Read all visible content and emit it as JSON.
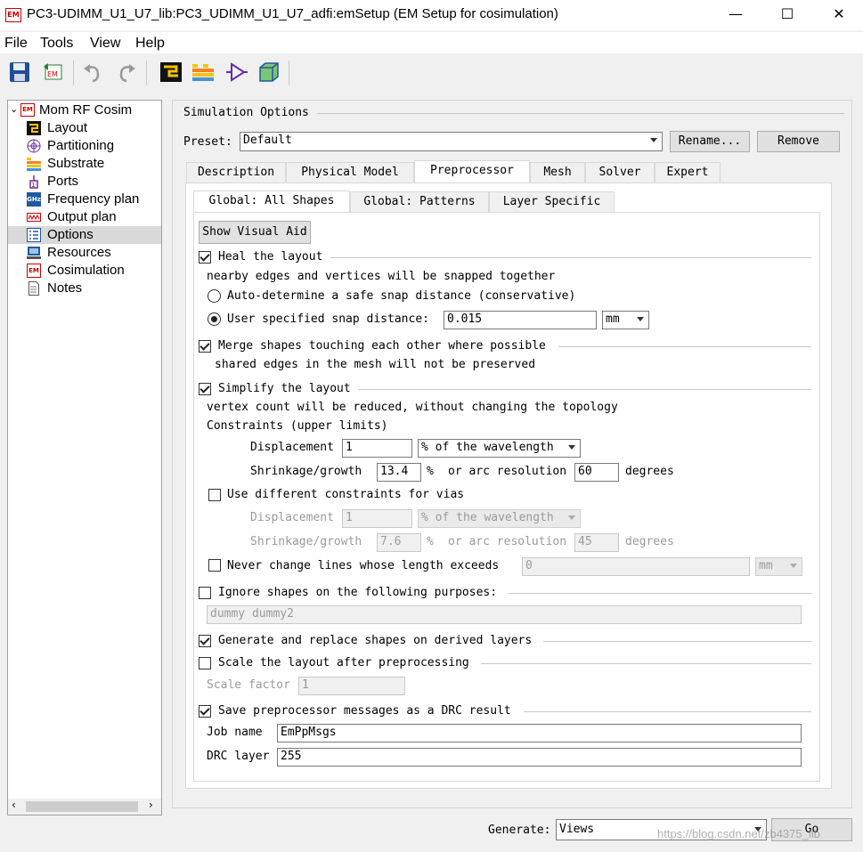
{
  "window": {
    "title": "PC3-UDIMM_U1_U7_lib:PC3_UDIMM_U1_U7_adfi:emSetup (EM Setup for cosimulation)",
    "badge": "EM",
    "minimize": "—",
    "maximize": "☐",
    "close": "✕"
  },
  "menu": [
    "File",
    "Tools",
    "View",
    "Help"
  ],
  "toolbar": [
    "save-icon",
    "export-icon",
    "undo-icon",
    "redo-icon",
    "layout-icon",
    "substrate-icon",
    "port-icon",
    "3d-view-icon"
  ],
  "tree": {
    "root": "Mom RF Cosim",
    "root_badge": "EM",
    "items": [
      {
        "label": "Layout",
        "icon": "layout-icon"
      },
      {
        "label": "Partitioning",
        "icon": "partitioning-icon"
      },
      {
        "label": "Substrate",
        "icon": "substrate-icon"
      },
      {
        "label": "Ports",
        "icon": "ports-icon"
      },
      {
        "label": "Frequency plan",
        "icon": "frequency-plan-icon",
        "badge": "GHz"
      },
      {
        "label": "Output plan",
        "icon": "output-plan-icon"
      },
      {
        "label": "Options",
        "icon": "options-icon"
      },
      {
        "label": "Resources",
        "icon": "resources-icon"
      },
      {
        "label": "Cosimulation",
        "icon": "cosimulation-icon",
        "badge": "EM"
      },
      {
        "label": "Notes",
        "icon": "notes-icon"
      }
    ],
    "selected": "Options"
  },
  "simulation": {
    "group_title": "Simulation Options",
    "preset_label": "Preset:",
    "preset_value": "Default",
    "rename_button": "Rename...",
    "remove_button": "Remove"
  },
  "tabs": [
    "Description",
    "Physical Model",
    "Preprocessor",
    "Mesh",
    "Solver",
    "Expert"
  ],
  "active_tab": "Preprocessor",
  "subtabs": [
    "Global: All Shapes",
    "Global: Patterns",
    "Layer Specific"
  ],
  "active_subtab": "Global: All Shapes",
  "pre": {
    "show_visual_aid": "Show Visual Aid",
    "heal": {
      "label": "Heal the layout",
      "checked": true,
      "desc": "nearby edges and vertices will be snapped together",
      "auto": "Auto-determine a safe snap distance (conservative)",
      "user": "User specified snap distance:",
      "snap_value": "0.015",
      "snap_unit": "mm"
    },
    "merge": {
      "label": "Merge shapes touching each other where possible",
      "checked": true,
      "desc": "shared edges in the mesh will not be preserved"
    },
    "simplify": {
      "label": "Simplify the layout",
      "checked": true,
      "desc": "vertex count will be reduced, without changing the topology",
      "constraints": "Constraints (upper limits)",
      "displacement_label": "Displacement",
      "displacement_value": "1",
      "displacement_unit": "% of the wavelength",
      "shrink_label": "Shrinkage/growth",
      "shrink_value": "13.4",
      "percent": "%",
      "arc_label": "or arc resolution",
      "arc_value": "60",
      "degrees": "degrees"
    },
    "vias": {
      "label": "Use different constraints for vias",
      "checked": false,
      "displacement_label": "Displacement",
      "displacement_value": "1",
      "displacement_unit": "% of the wavelength",
      "shrink_label": "Shrinkage/growth",
      "shrink_value": "7.6",
      "percent": "%",
      "arc_label": "or arc resolution",
      "arc_value": "45",
      "degrees": "degrees"
    },
    "never": {
      "label": "Never change lines whose length exceeds",
      "checked": false,
      "value": "0",
      "unit": "mm"
    },
    "ignore": {
      "label": "Ignore shapes on the following purposes:",
      "checked": false,
      "value": "dummy dummy2"
    },
    "generate": {
      "label": "Generate and replace shapes on derived layers",
      "checked": true
    },
    "scale": {
      "label": "Scale the layout after preprocessing",
      "checked": false,
      "factor_label": "Scale factor",
      "factor_value": "1"
    },
    "save": {
      "label": "Save preprocessor messages as a DRC result",
      "checked": true,
      "job_label": "Job name",
      "job_value": "EmPpMsgs",
      "drc_label": "DRC layer",
      "drc_value": "255"
    }
  },
  "footer": {
    "generate_label": "Generate:",
    "generate_value": "Views",
    "go_button": "Go",
    "watermark": "https://blog.csdn.net/zb4375_lib"
  }
}
